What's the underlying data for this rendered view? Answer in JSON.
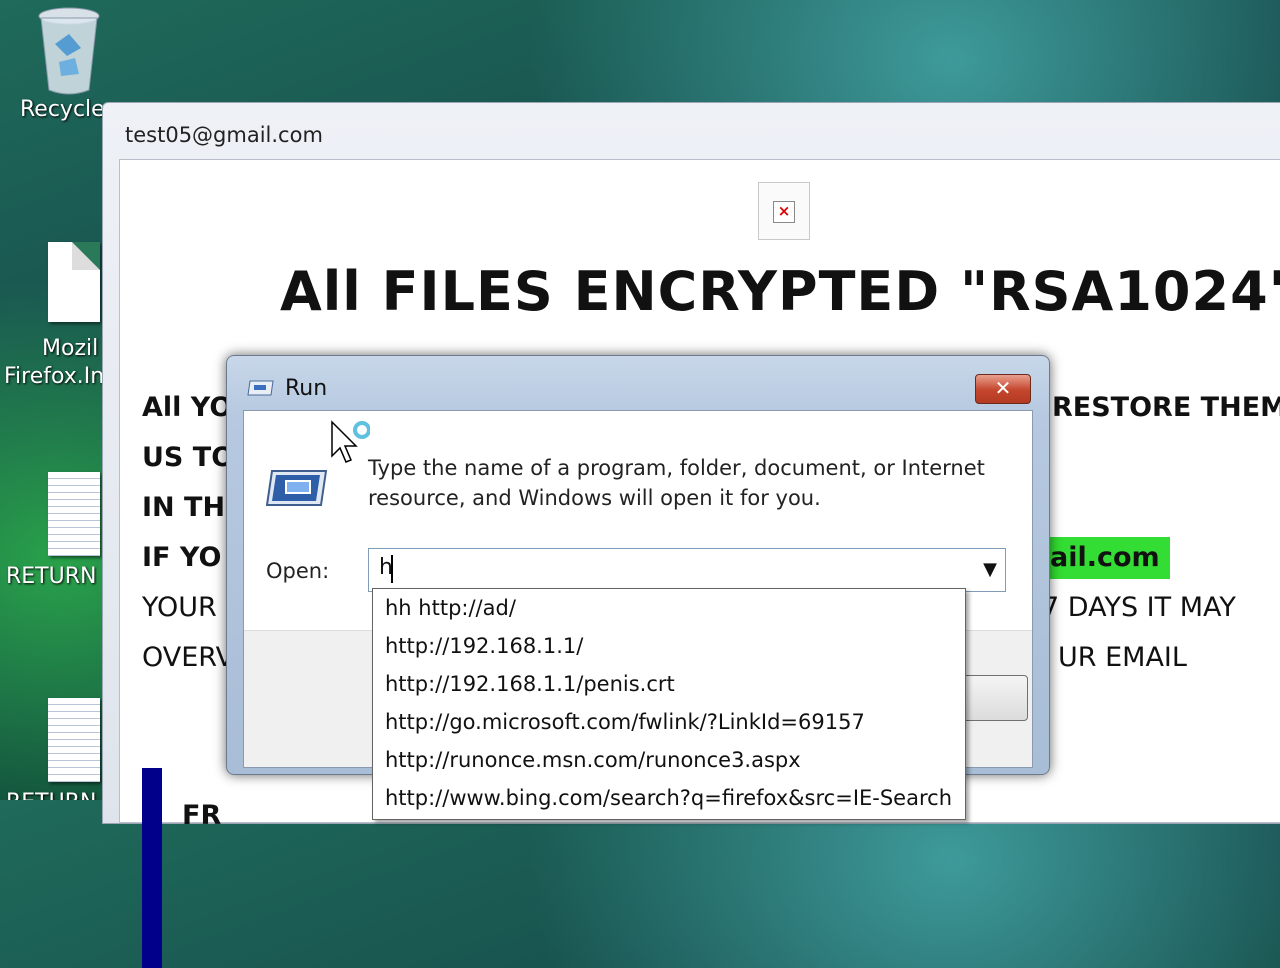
{
  "desktop": {
    "icons": [
      {
        "label": "Recycle"
      },
      {
        "label_line1": "Mozil",
        "label_line2": "Firefox.In"
      },
      {
        "label": "RETURN"
      },
      {
        "label": "RETURN"
      }
    ]
  },
  "ransom_window": {
    "title": "test05@gmail.com",
    "headline": "All FILES ENCRYPTED \"RSA1024\"",
    "lines": [
      {
        "left": "All YO",
        "right": "RESTORE THEM"
      },
      {
        "left": "US TO",
        "right": ""
      },
      {
        "left": "IN TH",
        "right": ""
      },
      {
        "left": "IF YO",
        "right": "ail.com"
      },
      {
        "left": "YOUR",
        "right": "7 DAYS IT MAY"
      },
      {
        "left": "OVERV",
        "right": "UR EMAIL"
      }
    ],
    "fr_text": "FR"
  },
  "run_dialog": {
    "title": "Run",
    "close_label": "✕",
    "description": "Type the name of a program, folder, document, or Internet resource, and Windows will open it for you.",
    "open_label": "Open:",
    "open_value": "h",
    "autocomplete": [
      "hh http://ad/",
      "http://192.168.1.1/",
      "http://192.168.1.1/penis.crt",
      "http://go.microsoft.com/fwlink/?LinkId=69157",
      "http://runonce.msn.com/runonce3.aspx",
      "http://www.bing.com/search?q=firefox&src=IE-Search"
    ]
  }
}
